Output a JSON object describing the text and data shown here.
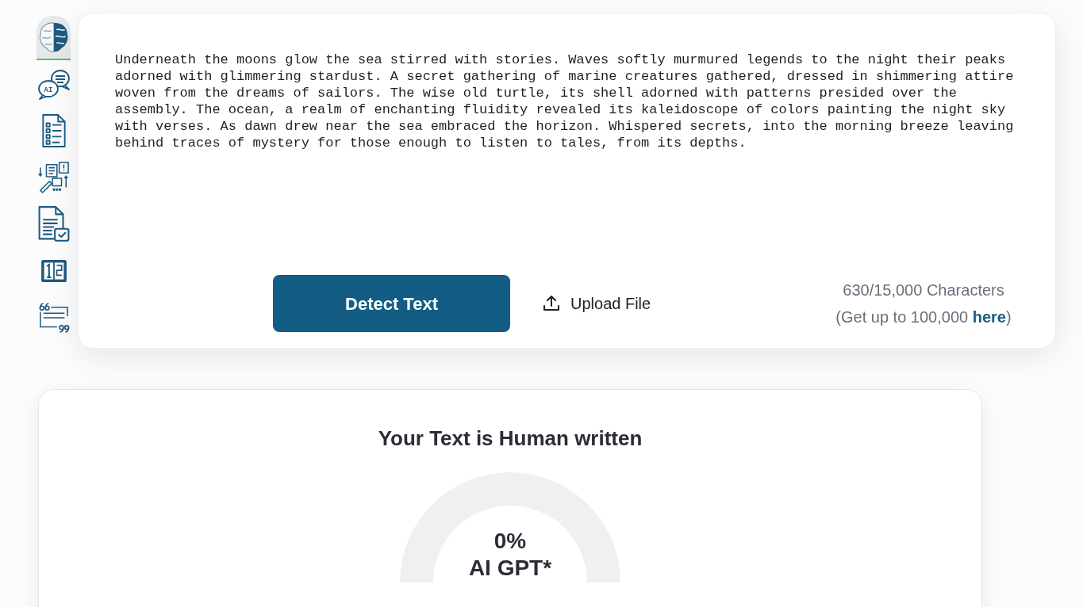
{
  "sidebar": {
    "items": [
      {
        "selected": true
      },
      {
        "selected": false,
        "label": "AI"
      },
      {
        "selected": false
      },
      {
        "selected": false
      },
      {
        "selected": false
      },
      {
        "selected": false
      },
      {
        "selected": false
      }
    ]
  },
  "editor": {
    "text": "Underneath the moons glow the sea stirred with stories. Waves softly murmured legends to the night their peaks adorned with glimmering stardust. A secret gathering of marine creatures gathered, dressed in shimmering attire woven from the dreams of sailors. The wise old turtle, its shell adorned with patterns presided over the assembly. The ocean, a realm of enchanting fluidity revealed its kaleidoscope of colors painting the night sky with verses. As dawn drew near the sea embraced the horizon. Whispered secrets, into the morning breeze leaving behind traces of mystery for those enough to listen to tales, from its depths."
  },
  "actions": {
    "detect_button": "Detect Text",
    "upload_button": "Upload File"
  },
  "counter": {
    "count": "630/15,000 Characters",
    "upgrade_before": "(Get up to 100,000 ",
    "upgrade_link": "here",
    "upgrade_after": ")"
  },
  "result": {
    "title": "Your Text is Human written",
    "gauge": {
      "value": "0%",
      "label": "AI GPT*"
    }
  }
}
